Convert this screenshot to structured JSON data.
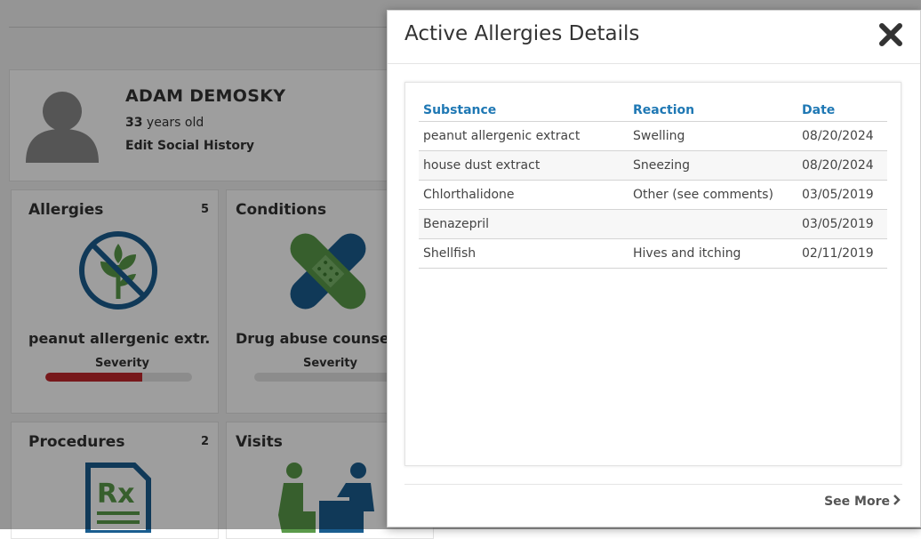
{
  "patient": {
    "name": "ADAM DEMOSKY",
    "age_value": "33",
    "age_suffix": " years old",
    "social_link": "Edit Social History"
  },
  "cards": [
    {
      "title": "Allergies",
      "count": "5",
      "subtitle": "peanut allergenic extr...",
      "severity_label": "Severity",
      "severity_fraction": 0.66,
      "icon": "no-plants-icon"
    },
    {
      "title": "Conditions",
      "count": "",
      "subtitle": "Drug abuse counseli",
      "severity_label": "Severity",
      "severity_fraction": 0,
      "icon": "bandage-icon"
    },
    {
      "title": "Procedures",
      "count": "2",
      "icon": "prescription-icon"
    },
    {
      "title": "Visits",
      "count": "",
      "icon": "doctor-visit-icon"
    }
  ],
  "modal": {
    "title": "Active Allergies Details",
    "close_icon": "close-icon",
    "columns": [
      "Substance",
      "Reaction",
      "Date"
    ],
    "rows": [
      [
        "peanut allergenic extract",
        "Swelling",
        "08/20/2024"
      ],
      [
        "house dust extract",
        "Sneezing",
        "08/20/2024"
      ],
      [
        "Chlorthalidone",
        "Other (see comments)",
        "03/05/2019"
      ],
      [
        "Benazepril",
        "",
        "03/05/2019"
      ],
      [
        "Shellfish",
        "Hives and itching",
        "02/11/2019"
      ]
    ],
    "see_more": "See More"
  },
  "colors": {
    "accent": "#1f78b4",
    "icon_blue": "#1a5d8f",
    "icon_green": "#5a9a4a",
    "severity_red": "#c0272d",
    "overlay": "rgba(0,0,0,0.38)"
  }
}
